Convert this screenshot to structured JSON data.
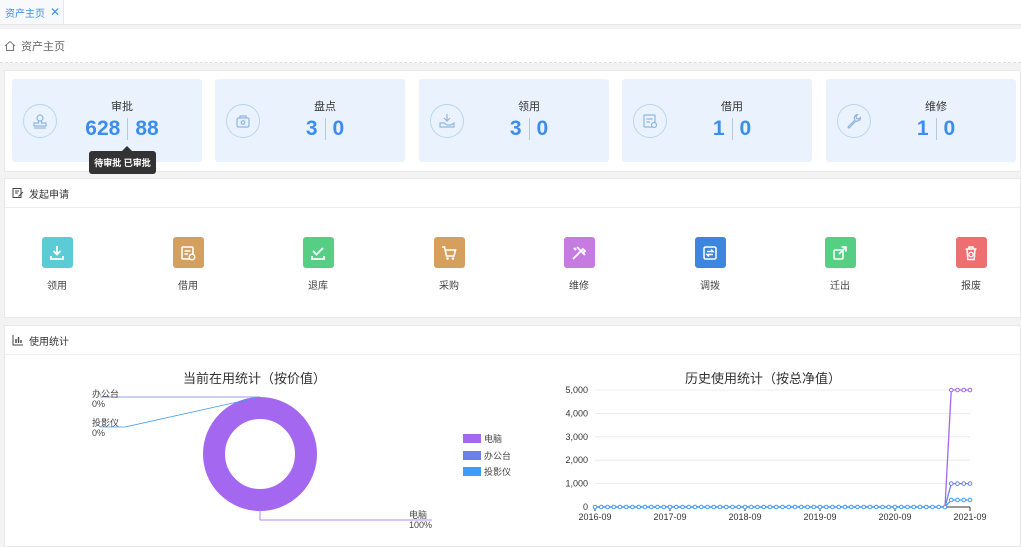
{
  "tab": {
    "label": "资产主页",
    "close": "✕"
  },
  "breadcrumb": {
    "label": "资产主页"
  },
  "stats": [
    {
      "title": "审批",
      "a": "628",
      "b": "88",
      "icon": "stamp-icon"
    },
    {
      "title": "盘点",
      "a": "3",
      "b": "0",
      "icon": "box-icon"
    },
    {
      "title": "领用",
      "a": "3",
      "b": "0",
      "icon": "hand-receive-icon"
    },
    {
      "title": "借用",
      "a": "1",
      "b": "0",
      "icon": "document-icon"
    },
    {
      "title": "维修",
      "a": "1",
      "b": "0",
      "icon": "wrench-icon"
    }
  ],
  "tooltip": "待审批 已审批",
  "apply_section": {
    "title": "发起申请"
  },
  "actions": [
    {
      "label": "领用",
      "color": "#5bcbd6",
      "icon": "download-icon"
    },
    {
      "label": "借用",
      "color": "#d59f5e",
      "icon": "borrow-icon"
    },
    {
      "label": "退库",
      "color": "#56cf84",
      "icon": "return-icon"
    },
    {
      "label": "采购",
      "color": "#d59f5e",
      "icon": "cart-icon"
    },
    {
      "label": "维修",
      "color": "#c57be0",
      "icon": "tools-icon"
    },
    {
      "label": "调拨",
      "color": "#3c86e0",
      "icon": "transfer-icon"
    },
    {
      "label": "迁出",
      "color": "#56cf84",
      "icon": "move-out-icon"
    },
    {
      "label": "报废",
      "color": "#ee6f6f",
      "icon": "trash-icon"
    }
  ],
  "usage_section": {
    "title": "使用统计"
  },
  "chart_data": [
    {
      "type": "pie",
      "title": "当前在用统计（按价值）",
      "labels": [
        "电脑",
        "办公台",
        "投影仪"
      ],
      "values": [
        100,
        0,
        0
      ],
      "percent_labels": [
        "100%",
        "0%",
        "0%"
      ],
      "colors": [
        "#a367f0",
        "#6d7fe8",
        "#3d9cf5"
      ],
      "legend": "right"
    },
    {
      "type": "line",
      "title": "历史使用统计（按总净值）",
      "x_ticks": [
        "2016-09",
        "2017-09",
        "2018-09",
        "2019-09",
        "2020-09",
        "2021-09"
      ],
      "y_ticks": [
        "0",
        "1,000",
        "2,000",
        "3,000",
        "4,000",
        "5,000"
      ],
      "ylim": [
        0,
        5000
      ],
      "x_range": [
        "2016-09",
        "2021-09"
      ],
      "x_points": 61,
      "grid": true,
      "series": [
        {
          "values_summary": "0 until 2021-06, then 5000",
          "end_value": 5000,
          "color": "#a367f0"
        },
        {
          "values_summary": "0 until 2021-06, then 1000",
          "end_value": 1000,
          "color": "#6d7fe8"
        },
        {
          "values_summary": "0 until 2021-06, then 300",
          "end_value": 300,
          "color": "#3d9cf5"
        }
      ]
    }
  ]
}
